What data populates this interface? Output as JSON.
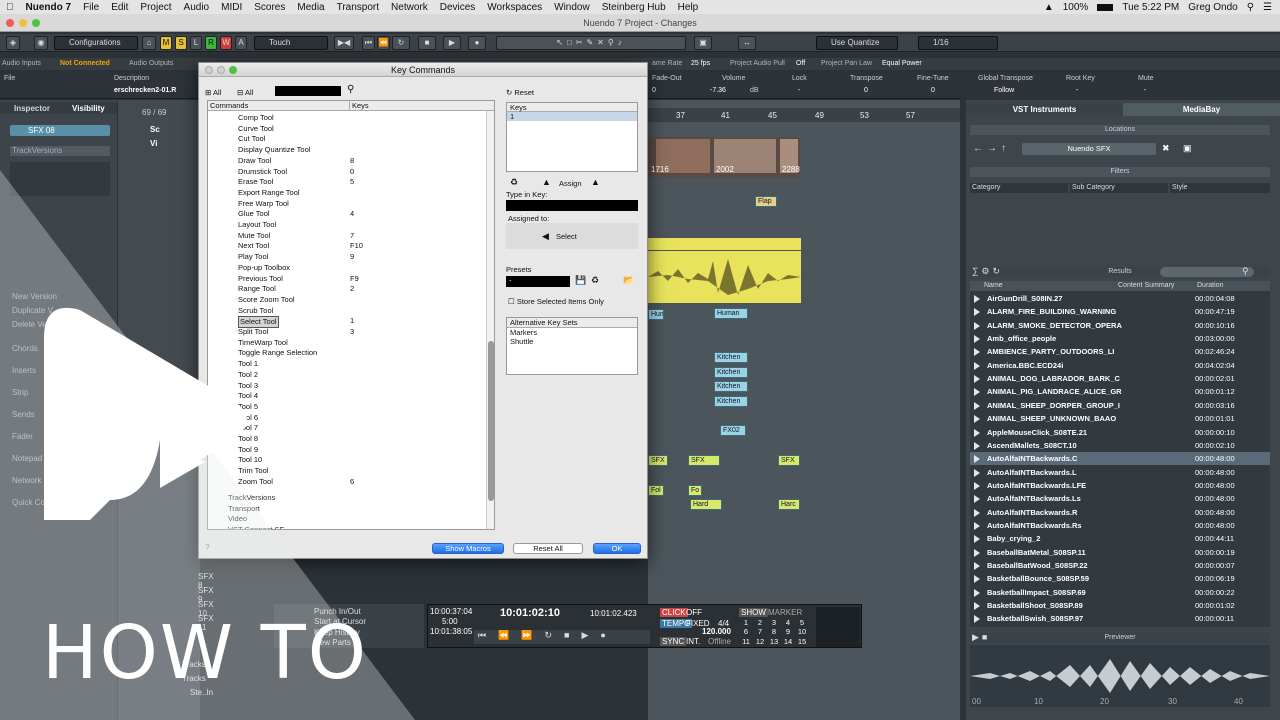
{
  "menubar": {
    "apple": "",
    "app": "Nuendo 7",
    "items": [
      "File",
      "Edit",
      "Project",
      "Audio",
      "MIDI",
      "Scores",
      "Media",
      "Transport",
      "Network",
      "Devices",
      "Workspaces",
      "Window",
      "Steinberg Hub",
      "Help"
    ],
    "battery": "100%",
    "clock": "Tue 5:22 PM",
    "user": "Greg Ondo"
  },
  "window_title": "Nuendo 7 Project - Changes",
  "toolbar": {
    "configurations": "Configurations",
    "touch": "Touch",
    "m": "M",
    "s": "S",
    "l": "L",
    "r": "R",
    "w": "W",
    "a": "A",
    "quantize": "Use Quantize",
    "grid": "1/16"
  },
  "infoline": {
    "audio_inputs": "Audio Inputs",
    "not_connected": "Not Connected",
    "audio_outputs": "Audio Outputs",
    "frame_rate_label": "ame Rate",
    "frame_rate": "25 fps",
    "pull_label": "Project Audio Pull",
    "pull": "Off",
    "pan_label": "Project Pan Law",
    "pan": "Equal Power"
  },
  "valueline": {
    "file": "File",
    "description_label": "Description",
    "description": "erschrecken2-01.R",
    "fadeout_label": "Fade-Out",
    "fadeout": "0",
    "volume_label": "Volume",
    "volume": "-7.36",
    "volume_unit": "dB",
    "lock_label": "Lock",
    "lock": "-",
    "transpose_label": "Transpose",
    "transpose": "0",
    "finetune_label": "Fine-Tune",
    "finetune": "0",
    "global_transpose_label": "Global Transpose",
    "global_transpose": "Follow",
    "rootkey_label": "Root Key",
    "rootkey": "-",
    "mute_label": "Mute",
    "mute": "-"
  },
  "inspector": {
    "tab1": "Inspector",
    "tab2": "Visibility",
    "track": "SFX 08",
    "trackversions": "TrackVersions",
    "new_version": "New Version",
    "duplicate": "Duplicate V",
    "delete": "Delete Ve",
    "sections": [
      "Chords",
      "Inserts",
      "Strip",
      "Sends",
      "Fader",
      "Notepad",
      "Network",
      "Quick Con"
    ],
    "sfx_rows": [
      "SFX 8",
      "SFX 9",
      "SFX 10",
      "SFX 11"
    ],
    "more_tracks": [
      "Tracks",
      "Tracks"
    ],
    "group": "Ste..In",
    "track_list_header": "69 / 69",
    "row_labels": [
      "Sc",
      "Vi"
    ]
  },
  "ruler": [
    "37",
    "41",
    "45",
    "49",
    "53",
    "57"
  ],
  "clips": {
    "video_frames": [
      "1716",
      "2002",
      "2288"
    ],
    "yellow1": "Flap",
    "human1": "Human",
    "human2": "Human",
    "kitchen": [
      "Kitchen",
      "Kitchen",
      "Kitchen",
      "Kitchen"
    ],
    "fx02": "FX02",
    "sfx": [
      "SFX",
      "SFX",
      "SFX"
    ],
    "fo": [
      "Fol",
      "Fo"
    ],
    "hard": [
      "Hard",
      "Harc"
    ],
    "misc": [
      "Ca",
      "Ca",
      "8"
    ]
  },
  "right_zone": {
    "tabs": [
      "VST Instruments",
      "MediaBay"
    ],
    "locations": "Locations",
    "location": "Nuendo SFX",
    "filters": "Filters",
    "filter_cols": [
      "Category",
      "Sub Category",
      "Style"
    ],
    "results": "Results",
    "columns": [
      "Name",
      "Content Summary",
      "Duration"
    ],
    "rows": [
      {
        "name": "AirGunDrill_S08IN.27",
        "dur": "00:00:04:08"
      },
      {
        "name": "ALARM_FIRE_BUILDING_WARNING",
        "dur": "00:00:47:19"
      },
      {
        "name": "ALARM_SMOKE_DETECTOR_OPERA",
        "dur": "00:00:10:16"
      },
      {
        "name": "Amb_office_people",
        "dur": "00:03:00:00"
      },
      {
        "name": "AMBIENCE_PARTY_OUTDOORS_LI",
        "dur": "00:02:46:24"
      },
      {
        "name": "America.BBC.ECD24i",
        "dur": "00:04:02:04"
      },
      {
        "name": "ANIMAL_DOG_LABRADOR_BARK_C",
        "dur": "00:00:02:01"
      },
      {
        "name": "ANIMAL_PIG_LANDRACE_ALICE_GR",
        "dur": "00:00:01:12"
      },
      {
        "name": "ANIMAL_SHEEP_DORPER_GROUP_I",
        "dur": "00:00:03:16"
      },
      {
        "name": "ANIMAL_SHEEP_UNKNOWN_BAAO",
        "dur": "00:00:01:01"
      },
      {
        "name": "AppleMouseClick_S08TE.21",
        "dur": "00:00:00:10"
      },
      {
        "name": "AscendMallets_S08CT.10",
        "dur": "00:00:02:10"
      },
      {
        "name": "AutoAlfaINTBackwards.C",
        "dur": "00:00:48:00"
      },
      {
        "name": "AutoAlfaINTBackwards.L",
        "dur": "00:00:48:00"
      },
      {
        "name": "AutoAlfaINTBackwards.LFE",
        "dur": "00:00:48:00"
      },
      {
        "name": "AutoAlfaINTBackwards.Ls",
        "dur": "00:00:48:00"
      },
      {
        "name": "AutoAlfaINTBackwards.R",
        "dur": "00:00:48:00"
      },
      {
        "name": "AutoAlfaINTBackwards.Rs",
        "dur": "00:00:48:00"
      },
      {
        "name": "Baby_crying_2",
        "dur": "00:00:44:11"
      },
      {
        "name": "BaseballBatMetal_S08SP.11",
        "dur": "00:00:00:19"
      },
      {
        "name": "BaseballBatWood_S08SP.22",
        "dur": "00:00:00:07"
      },
      {
        "name": "BasketballBounce_S08SP.59",
        "dur": "00:00:06:19"
      },
      {
        "name": "BasketballImpact_S08SP.69",
        "dur": "00:00:00:22"
      },
      {
        "name": "BasketballShoot_S08SP.89",
        "dur": "00:00:01:02"
      },
      {
        "name": "BasketballSwish_S08SP.97",
        "dur": "00:00:00:11"
      }
    ],
    "previewer": "Previewer",
    "wave_ticks": [
      "00",
      "10",
      "20",
      "30",
      "40"
    ]
  },
  "dialog": {
    "title": "Key Commands",
    "all1": "All",
    "all2": "All",
    "reset": "Reset",
    "col_commands": "Commands",
    "col_keys": "Keys",
    "keys_panel": "Keys",
    "keys_value": "1",
    "assign": "Assign",
    "type_in_key": "Type in Key:",
    "assigned_to": "Assigned to:",
    "select": "Select",
    "presets": "Presets",
    "preset_value": "-",
    "store_selected": "Store Selected Items Only",
    "alt_sets": "Alternative Key Sets",
    "alt_items": [
      "Markers",
      "Shuttle"
    ],
    "show_macros": "Show Macros",
    "reset_all": "Reset All",
    "ok": "OK",
    "commands": [
      {
        "name": "Comp Tool",
        "key": ""
      },
      {
        "name": "Curve Tool",
        "key": ""
      },
      {
        "name": "Cut Tool",
        "key": ""
      },
      {
        "name": "Display Quantize Tool",
        "key": ""
      },
      {
        "name": "Draw Tool",
        "key": "8"
      },
      {
        "name": "Drumstick Tool",
        "key": "0"
      },
      {
        "name": "Erase Tool",
        "key": "5"
      },
      {
        "name": "Export Range Tool",
        "key": ""
      },
      {
        "name": "Free Warp Tool",
        "key": ""
      },
      {
        "name": "Glue Tool",
        "key": "4"
      },
      {
        "name": "Layout Tool",
        "key": ""
      },
      {
        "name": "Mute Tool",
        "key": "7"
      },
      {
        "name": "Next Tool",
        "key": "F10"
      },
      {
        "name": "Play Tool",
        "key": "9"
      },
      {
        "name": "Pop-up Toolbox",
        "key": ""
      },
      {
        "name": "Previous Tool",
        "key": "F9"
      },
      {
        "name": "Range Tool",
        "key": "2"
      },
      {
        "name": "Score Zoom Tool",
        "key": ""
      },
      {
        "name": "Scrub Tool",
        "key": ""
      },
      {
        "name": "Select Tool",
        "key": "1"
      },
      {
        "name": "Split Tool",
        "key": "3"
      },
      {
        "name": "TimeWarp Tool",
        "key": ""
      },
      {
        "name": "Toggle Range Selection",
        "key": ""
      },
      {
        "name": "Tool 1",
        "key": ""
      },
      {
        "name": "Tool 2",
        "key": ""
      },
      {
        "name": "Tool 3",
        "key": ""
      },
      {
        "name": "Tool 4",
        "key": ""
      },
      {
        "name": "Tool 5",
        "key": ""
      },
      {
        "name": "Tool 6",
        "key": ""
      },
      {
        "name": "Tool 7",
        "key": ""
      },
      {
        "name": "Tool 8",
        "key": ""
      },
      {
        "name": "Tool 9",
        "key": ""
      },
      {
        "name": "Tool 10",
        "key": ""
      },
      {
        "name": "Trim Tool",
        "key": ""
      },
      {
        "name": "Zoom Tool",
        "key": "6"
      }
    ],
    "folders": [
      "TrackVersions",
      "Transport",
      "Video",
      "VST Connect SE"
    ]
  },
  "transport": {
    "primary": "10:01:02:10",
    "secondary": "10:01:02.423",
    "left_top": "10:00:37:04",
    "left_bot": "10:01:38:05",
    "left_mid": "5:00",
    "click": "CLICK",
    "click_val": "OFF",
    "tempo": "TEMPO",
    "tempo_mode": "FIXED",
    "signature": "4/4",
    "bpm": "120.000",
    "sync": "SYNC",
    "sync_mode": "INT.",
    "sync_val": "Offline",
    "show": "SHOW",
    "marker": "MARKER",
    "markers": [
      "1",
      "2",
      "3",
      "4",
      "5",
      "6",
      "7",
      "8",
      "9",
      "10",
      "11",
      "12",
      "13",
      "14",
      "15"
    ],
    "history": [
      "Punch In/Out",
      "Start at Cursor",
      "Keep History",
      "New Parts"
    ]
  },
  "overlay": {
    "howto": "HOW TO"
  },
  "colors": {
    "accent": "#f0a400",
    "clip_cyan": "#9bd3e3",
    "clip_yellow": "#e8e85c",
    "dialog_button": "#1e6fe6"
  }
}
